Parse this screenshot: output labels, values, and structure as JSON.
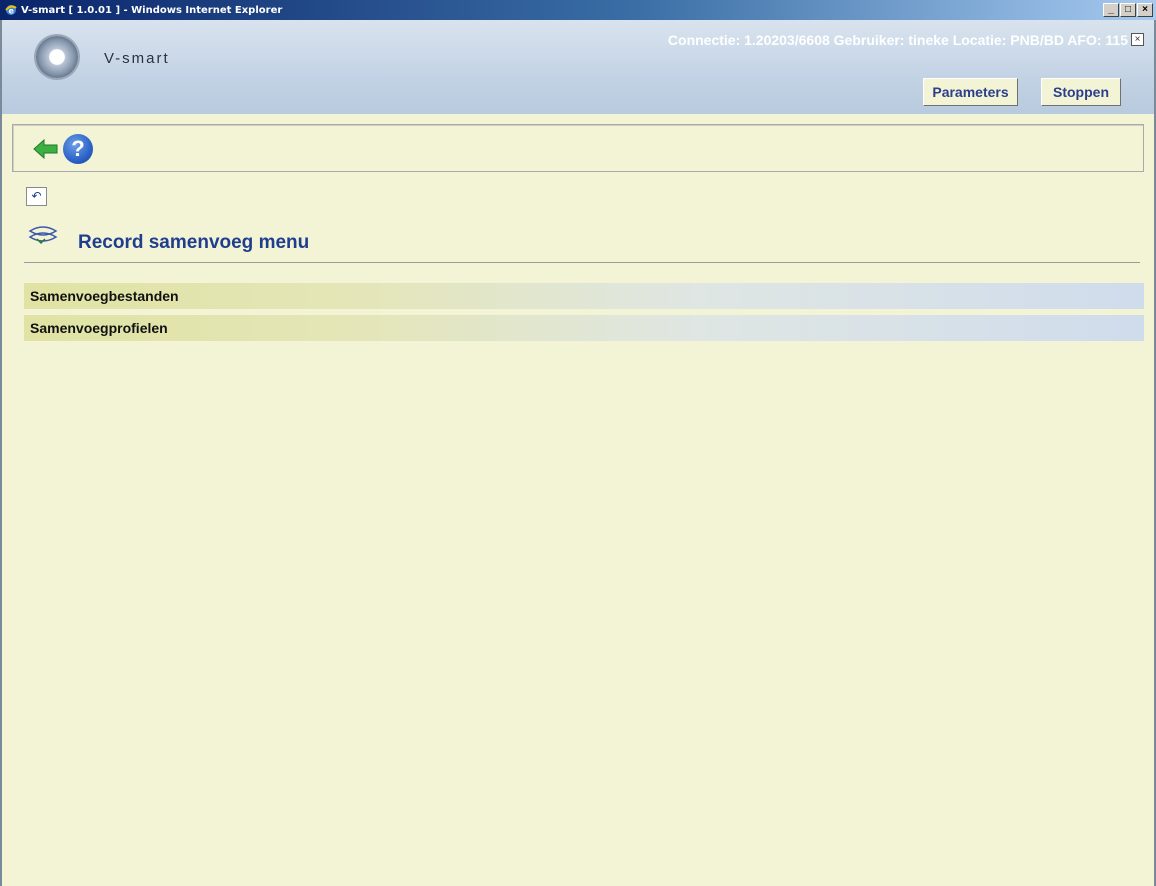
{
  "window": {
    "title": "V-smart [ 1.0.01 ] - Windows Internet Explorer",
    "buttons": [
      "_",
      "□",
      "×"
    ]
  },
  "header": {
    "logo_text": "V-smart",
    "connection_info": "Connectie: 1.20203/6608   Gebruiker: tineke   Locatie: PNB/BD   AFO: 115",
    "close_label": "×",
    "parameters_label": "Parameters",
    "stop_label": "Stoppen"
  },
  "toolbar": {
    "help_label": "?"
  },
  "page": {
    "title": "Record samenvoeg menu",
    "menu_items": [
      {
        "label": "Samenvoegbestanden"
      },
      {
        "label": "Samenvoegprofielen"
      }
    ]
  },
  "colors": {
    "background": "#f3f3d6",
    "title_blue": "#1f3f8e",
    "header_top": "#d9e3ee"
  },
  "icons": [
    "ie-icon",
    "logo-icon",
    "back-arrow-icon",
    "help-icon",
    "undo-icon",
    "merge-records-icon"
  ]
}
